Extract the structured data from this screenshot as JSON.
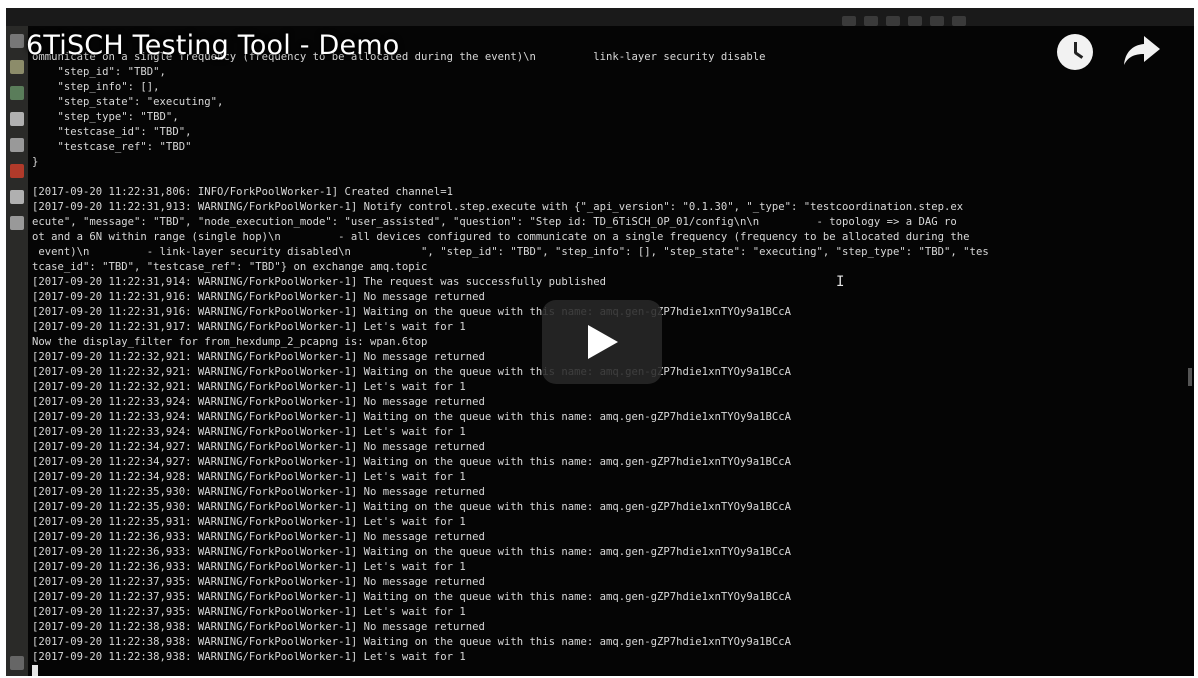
{
  "video": {
    "title": "6TiSCH Testing Tool - Demo",
    "icons": {
      "watch_later": "clock-icon",
      "share": "share-arrow-icon",
      "play": "play-icon"
    }
  },
  "terminal": {
    "lines": [
      "ommunicate on a single frequency (frequency to be allocated during the event)\\n         link-layer security disable",
      "    \"step_id\": \"TBD\",",
      "    \"step_info\": [],",
      "    \"step_state\": \"executing\",",
      "    \"step_type\": \"TBD\",",
      "    \"testcase_id\": \"TBD\",",
      "    \"testcase_ref\": \"TBD\"",
      "}",
      "",
      "[2017-09-20 11:22:31,806: INFO/ForkPoolWorker-1] Created channel=1",
      "[2017-09-20 11:22:31,913: WARNING/ForkPoolWorker-1] Notify control.step.execute with {\"_api_version\": \"0.1.30\", \"_type\": \"testcoordination.step.ex",
      "ecute\", \"message\": \"TBD\", \"node_execution_mode\": \"user_assisted\", \"question\": \"Step id: TD_6TiSCH_OP_01/config\\n\\n         - topology => a DAG ro",
      "ot and a 6N within range (single hop)\\n         - all devices configured to communicate on a single frequency (frequency to be allocated during the",
      " event)\\n         - link-layer security disabled\\n           \", \"step_id\": \"TBD\", \"step_info\": [], \"step_state\": \"executing\", \"step_type\": \"TBD\", \"tes",
      "tcase_id\": \"TBD\", \"testcase_ref\": \"TBD\"} on exchange amq.topic",
      "[2017-09-20 11:22:31,914: WARNING/ForkPoolWorker-1] The request was successfully published",
      "[2017-09-20 11:22:31,916: WARNING/ForkPoolWorker-1] No message returned",
      "[2017-09-20 11:22:31,916: WARNING/ForkPoolWorker-1] Waiting on the queue with this name: amq.gen-gZP7hdie1xnTYOy9a1BCcA",
      "[2017-09-20 11:22:31,917: WARNING/ForkPoolWorker-1] Let's wait for 1",
      "Now the display_filter for from_hexdump_2_pcapng is: wpan.6top",
      "[2017-09-20 11:22:32,921: WARNING/ForkPoolWorker-1] No message returned",
      "[2017-09-20 11:22:32,921: WARNING/ForkPoolWorker-1] Waiting on the queue with this name: amq.gen-gZP7hdie1xnTYOy9a1BCcA",
      "[2017-09-20 11:22:32,921: WARNING/ForkPoolWorker-1] Let's wait for 1",
      "[2017-09-20 11:22:33,924: WARNING/ForkPoolWorker-1] No message returned",
      "[2017-09-20 11:22:33,924: WARNING/ForkPoolWorker-1] Waiting on the queue with this name: amq.gen-gZP7hdie1xnTYOy9a1BCcA",
      "[2017-09-20 11:22:33,924: WARNING/ForkPoolWorker-1] Let's wait for 1",
      "[2017-09-20 11:22:34,927: WARNING/ForkPoolWorker-1] No message returned",
      "[2017-09-20 11:22:34,927: WARNING/ForkPoolWorker-1] Waiting on the queue with this name: amq.gen-gZP7hdie1xnTYOy9a1BCcA",
      "[2017-09-20 11:22:34,928: WARNING/ForkPoolWorker-1] Let's wait for 1",
      "[2017-09-20 11:22:35,930: WARNING/ForkPoolWorker-1] No message returned",
      "[2017-09-20 11:22:35,930: WARNING/ForkPoolWorker-1] Waiting on the queue with this name: amq.gen-gZP7hdie1xnTYOy9a1BCcA",
      "[2017-09-20 11:22:35,931: WARNING/ForkPoolWorker-1] Let's wait for 1",
      "[2017-09-20 11:22:36,933: WARNING/ForkPoolWorker-1] No message returned",
      "[2017-09-20 11:22:36,933: WARNING/ForkPoolWorker-1] Waiting on the queue with this name: amq.gen-gZP7hdie1xnTYOy9a1BCcA",
      "[2017-09-20 11:22:36,933: WARNING/ForkPoolWorker-1] Let's wait for 1",
      "[2017-09-20 11:22:37,935: WARNING/ForkPoolWorker-1] No message returned",
      "[2017-09-20 11:22:37,935: WARNING/ForkPoolWorker-1] Waiting on the queue with this name: amq.gen-gZP7hdie1xnTYOy9a1BCcA",
      "[2017-09-20 11:22:37,935: WARNING/ForkPoolWorker-1] Let's wait for 1",
      "[2017-09-20 11:22:38,938: WARNING/ForkPoolWorker-1] No message returned",
      "[2017-09-20 11:22:38,938: WARNING/ForkPoolWorker-1] Waiting on the queue with this name: amq.gen-gZP7hdie1xnTYOy9a1BCcA",
      "[2017-09-20 11:22:38,938: WARNING/ForkPoolWorker-1] Let's wait for 1"
    ]
  },
  "launcher": {
    "icons": [
      "files-icon",
      "app-icon",
      "app-icon",
      "app-icon",
      "terminal-icon",
      "app-icon",
      "app-icon",
      "app-icon",
      "trash-icon"
    ]
  }
}
